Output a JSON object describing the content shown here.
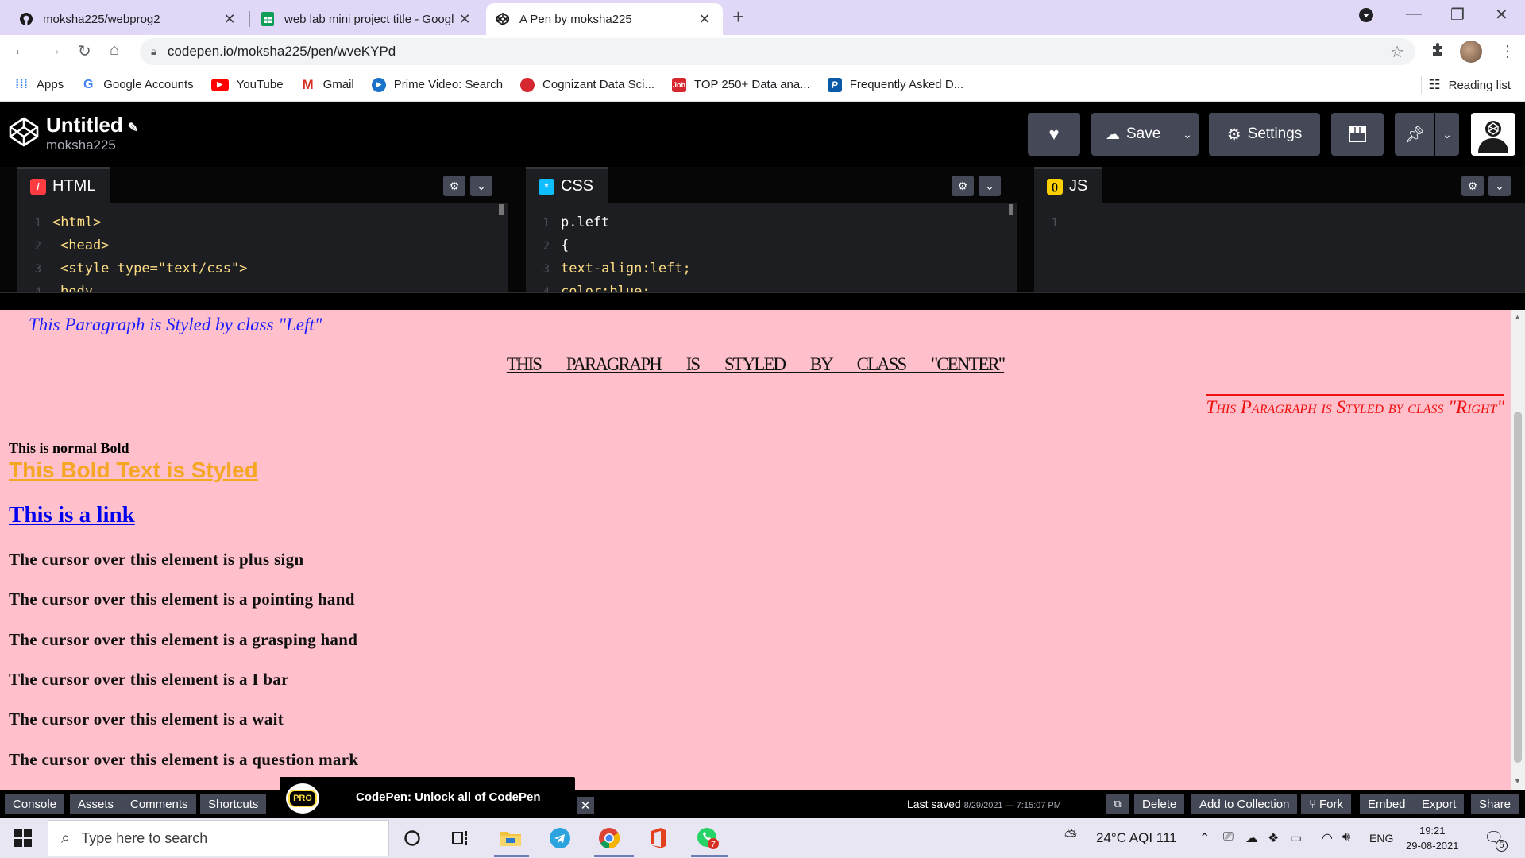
{
  "browser": {
    "tabs": [
      {
        "title": "moksha225/webprog2",
        "icon": "github-icon"
      },
      {
        "title": "web lab mini project title - Googl",
        "icon": "sheets-icon"
      },
      {
        "title": "A Pen by moksha225",
        "icon": "codepen-icon",
        "active": true
      }
    ],
    "url": "codepen.io/moksha225/pen/wveKYPd",
    "bookmarks": [
      {
        "label": "Apps",
        "icon": "apps-grid-icon",
        "color": "#4285f4"
      },
      {
        "label": "Google Accounts",
        "icon": "google-icon",
        "color": "#4285f4"
      },
      {
        "label": "YouTube",
        "icon": "youtube-icon",
        "color": "#ff0000"
      },
      {
        "label": "Gmail",
        "icon": "gmail-icon",
        "color": "#d93025"
      },
      {
        "label": "Prime Video: Search",
        "icon": "prime-video-icon",
        "color": "#1a73c8"
      },
      {
        "label": "Cognizant Data Sci...",
        "icon": "cognizant-icon",
        "color": "#d6262f"
      },
      {
        "label": "TOP 250+ Data ana...",
        "icon": "job-icon",
        "color": "#d6262f"
      },
      {
        "label": "Frequently Asked D...",
        "icon": "p-icon",
        "color": "#0a5aa8"
      }
    ],
    "reading_list": "Reading list"
  },
  "codepen": {
    "title": "Untitled",
    "user": "moksha225",
    "buttons": {
      "save": "Save",
      "settings": "Settings"
    },
    "panes": [
      {
        "name": "HTML",
        "color": "#ff3c41",
        "icon": "H",
        "lines": [
          "<html>",
          "<head>",
          "<style type=\"text/css\">",
          "body"
        ],
        "nums": [
          "1",
          "2",
          "3",
          "4"
        ]
      },
      {
        "name": "CSS",
        "color": "#0ebeff",
        "icon": "*",
        "lines": [
          "p.left",
          "{",
          "text-align:left;",
          "color:blue;"
        ],
        "nums": [
          "1",
          "2",
          "3",
          "4"
        ]
      },
      {
        "name": "JS",
        "color": "#fcd000",
        "icon": "()",
        "lines": [],
        "nums": [
          "1"
        ]
      }
    ]
  },
  "preview": {
    "left": "This Paragraph is Styled by class \"Left\"",
    "center": "This Paragraph is Styled by class \"Center\"",
    "right": "This Paragraph is Styled by class \"Right\"",
    "bold_normal": "This is normal Bold",
    "bold_styled": "This Bold Text is Styled",
    "link": "This is a link",
    "cursor_lines": [
      "The cursor over this element is plus sign",
      "The cursor over this element is a pointing hand",
      "The cursor over this element is a grasping hand",
      "The cursor over this element is a I bar",
      "The cursor over this element is a wait",
      "The cursor over this element is a question mark"
    ],
    "background": "#ffc0cb"
  },
  "bottom": {
    "left_buttons": [
      "Console",
      "Assets",
      "Comments",
      "Shortcuts"
    ],
    "promo": "CodePen: Unlock all of CodePen",
    "promo_badge": "PRO",
    "last_saved_label": "Last saved",
    "last_saved_time": "8/29/2021 — 7:15:07 PM",
    "right_buttons": [
      "Delete",
      "Add to Collection",
      "Fork",
      "Embed",
      "Export",
      "Share"
    ]
  },
  "taskbar": {
    "search_placeholder": "Type here to search",
    "weather": "24°C  AQI 111",
    "lang": "ENG",
    "time": "19:21",
    "date": "29-08-2021",
    "whatsapp_badge": "7",
    "notif_count": "5"
  }
}
